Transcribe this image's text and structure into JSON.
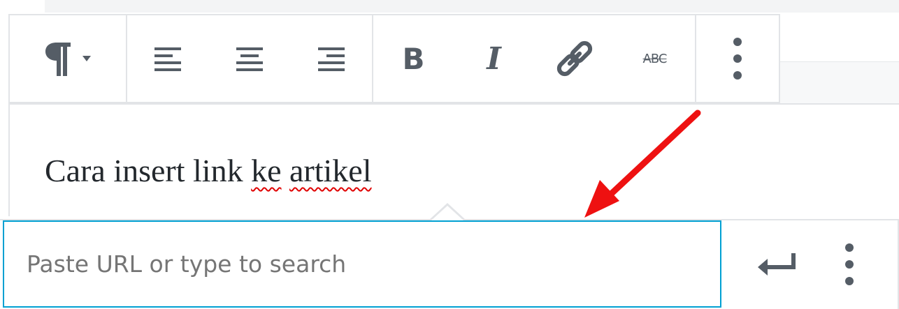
{
  "toolbar": {
    "paragraph_icon": "paragraph-icon",
    "paragraph_caret_icon": "caret-down-icon",
    "align_left_icon": "align-left-icon",
    "align_center_icon": "align-center-icon",
    "align_right_icon": "align-right-icon",
    "bold_label": "B",
    "italic_label": "I",
    "link_icon": "link-icon",
    "strikethrough_label": "ABC",
    "more_icon": "vertical-ellipsis-icon"
  },
  "content": {
    "text_before": "Cara insert link ",
    "misspelled_1": "ke",
    "space": " ",
    "misspelled_2": "artikel"
  },
  "link_popover": {
    "input_value": "",
    "input_placeholder": "Paste URL or type to search",
    "submit_icon": "enter-return-icon",
    "more_icon": "vertical-ellipsis-icon"
  },
  "annotation": {
    "arrow_color": "#ee1111"
  },
  "colors": {
    "accent": "#00a0d2",
    "icon": "#555d66",
    "border": "#e2e4e7",
    "text": "#23282d",
    "spellcheck": "#e00000"
  }
}
